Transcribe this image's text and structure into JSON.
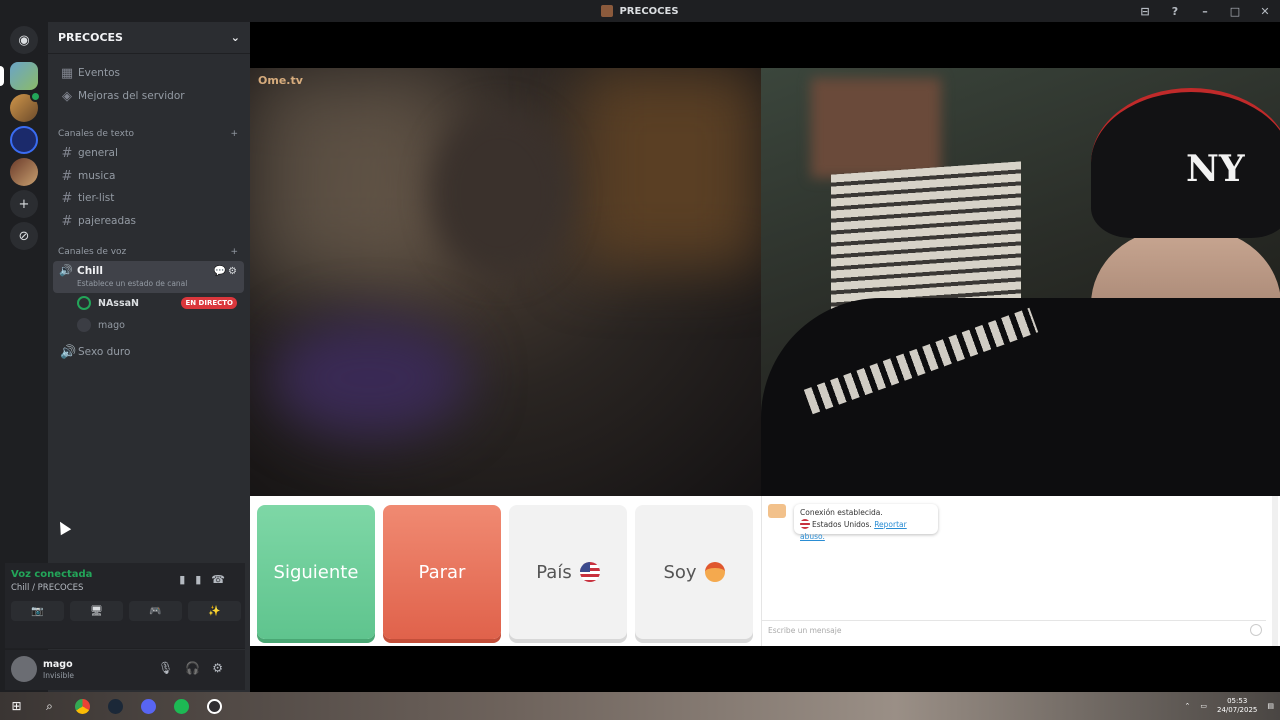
{
  "window": {
    "title": "PRECOCES",
    "controls": [
      "⊟",
      "?",
      "–",
      "□",
      "✕"
    ]
  },
  "guilds": [
    {
      "name": "discord-home-icon",
      "glyph": "◉"
    },
    {
      "name": "server-1-icon",
      "glyph": ""
    },
    {
      "name": "server-2-icon",
      "glyph": ""
    },
    {
      "name": "server-3-icon",
      "glyph": ""
    },
    {
      "name": "server-4-icon",
      "glyph": ""
    },
    {
      "name": "add-server-icon",
      "glyph": "+"
    },
    {
      "name": "explore-icon",
      "glyph": "⊘"
    }
  ],
  "server": {
    "name": "PRECOCES",
    "chevron": "⌄"
  },
  "nav": {
    "events": "Eventos",
    "boosts": "Mejoras del servidor"
  },
  "text_category": {
    "label": "Canales de texto",
    "add": "+"
  },
  "text_channels": [
    "general",
    "musica",
    "tier-list",
    "pajereadas"
  ],
  "voice_category": {
    "label": "Canales de voz",
    "add": "+"
  },
  "voice_channel": {
    "name": "Chill",
    "status": "Establece un estado de canal",
    "icons": "💬⚙"
  },
  "voice_users": [
    {
      "name": "NAssaN",
      "badge": "EN DIRECTO"
    },
    {
      "name": "mago",
      "badge": ""
    }
  ],
  "voice_channel_2": {
    "name": "Sexo duro"
  },
  "voice_panel": {
    "status": "Voz conectada",
    "location": "Chill / PRECOCES",
    "buttons": [
      "📷",
      "🖥",
      "🎮",
      "✨"
    ]
  },
  "user_panel": {
    "name": "mago",
    "status": "Invisible"
  },
  "ometv": {
    "logo": "Ome.tv"
  },
  "controls": {
    "next": "Siguiente",
    "stop": "Parar",
    "country": "País",
    "iam": "Soy"
  },
  "chat": {
    "msg1": "Conexión establecida.",
    "country": "Estados Unidos.",
    "report": "Reportar abuso.",
    "placeholder": "Escribe un mensaje"
  },
  "taskbar": {
    "time": "05:53",
    "date": "24/07/2025"
  }
}
